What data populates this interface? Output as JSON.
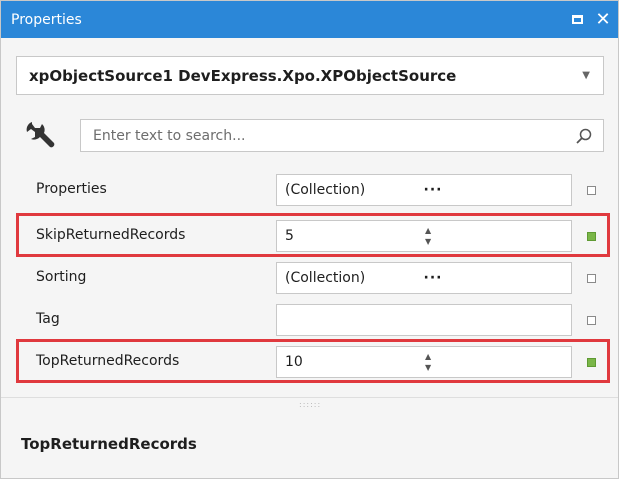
{
  "window": {
    "title": "Properties"
  },
  "object_selector": {
    "value": "xpObjectSource1  DevExpress.Xpo.XPObjectSource"
  },
  "search": {
    "placeholder": "Enter text to search..."
  },
  "properties": [
    {
      "label": "Properties",
      "value": "(Collection)",
      "editor": "ellipsis",
      "state": "default"
    },
    {
      "label": "SkipReturnedRecords",
      "value": "5",
      "editor": "spin",
      "state": "set",
      "highlighted": true
    },
    {
      "label": "Sorting",
      "value": "(Collection)",
      "editor": "ellipsis",
      "state": "default"
    },
    {
      "label": "Tag",
      "value": "",
      "editor": "text",
      "state": "default"
    },
    {
      "label": "TopReturnedRecords",
      "value": "10",
      "editor": "spin",
      "state": "set",
      "highlighted": true
    }
  ],
  "description": {
    "title": "TopReturnedRecords"
  },
  "colors": {
    "titlebar": "#2b87d8",
    "highlight": "#e0393e",
    "modified_marker": "#7ab648"
  },
  "icons": {
    "window": [
      "maximize-icon",
      "close-icon"
    ],
    "toolbar": "wrench-icon",
    "search": "search-icon"
  }
}
